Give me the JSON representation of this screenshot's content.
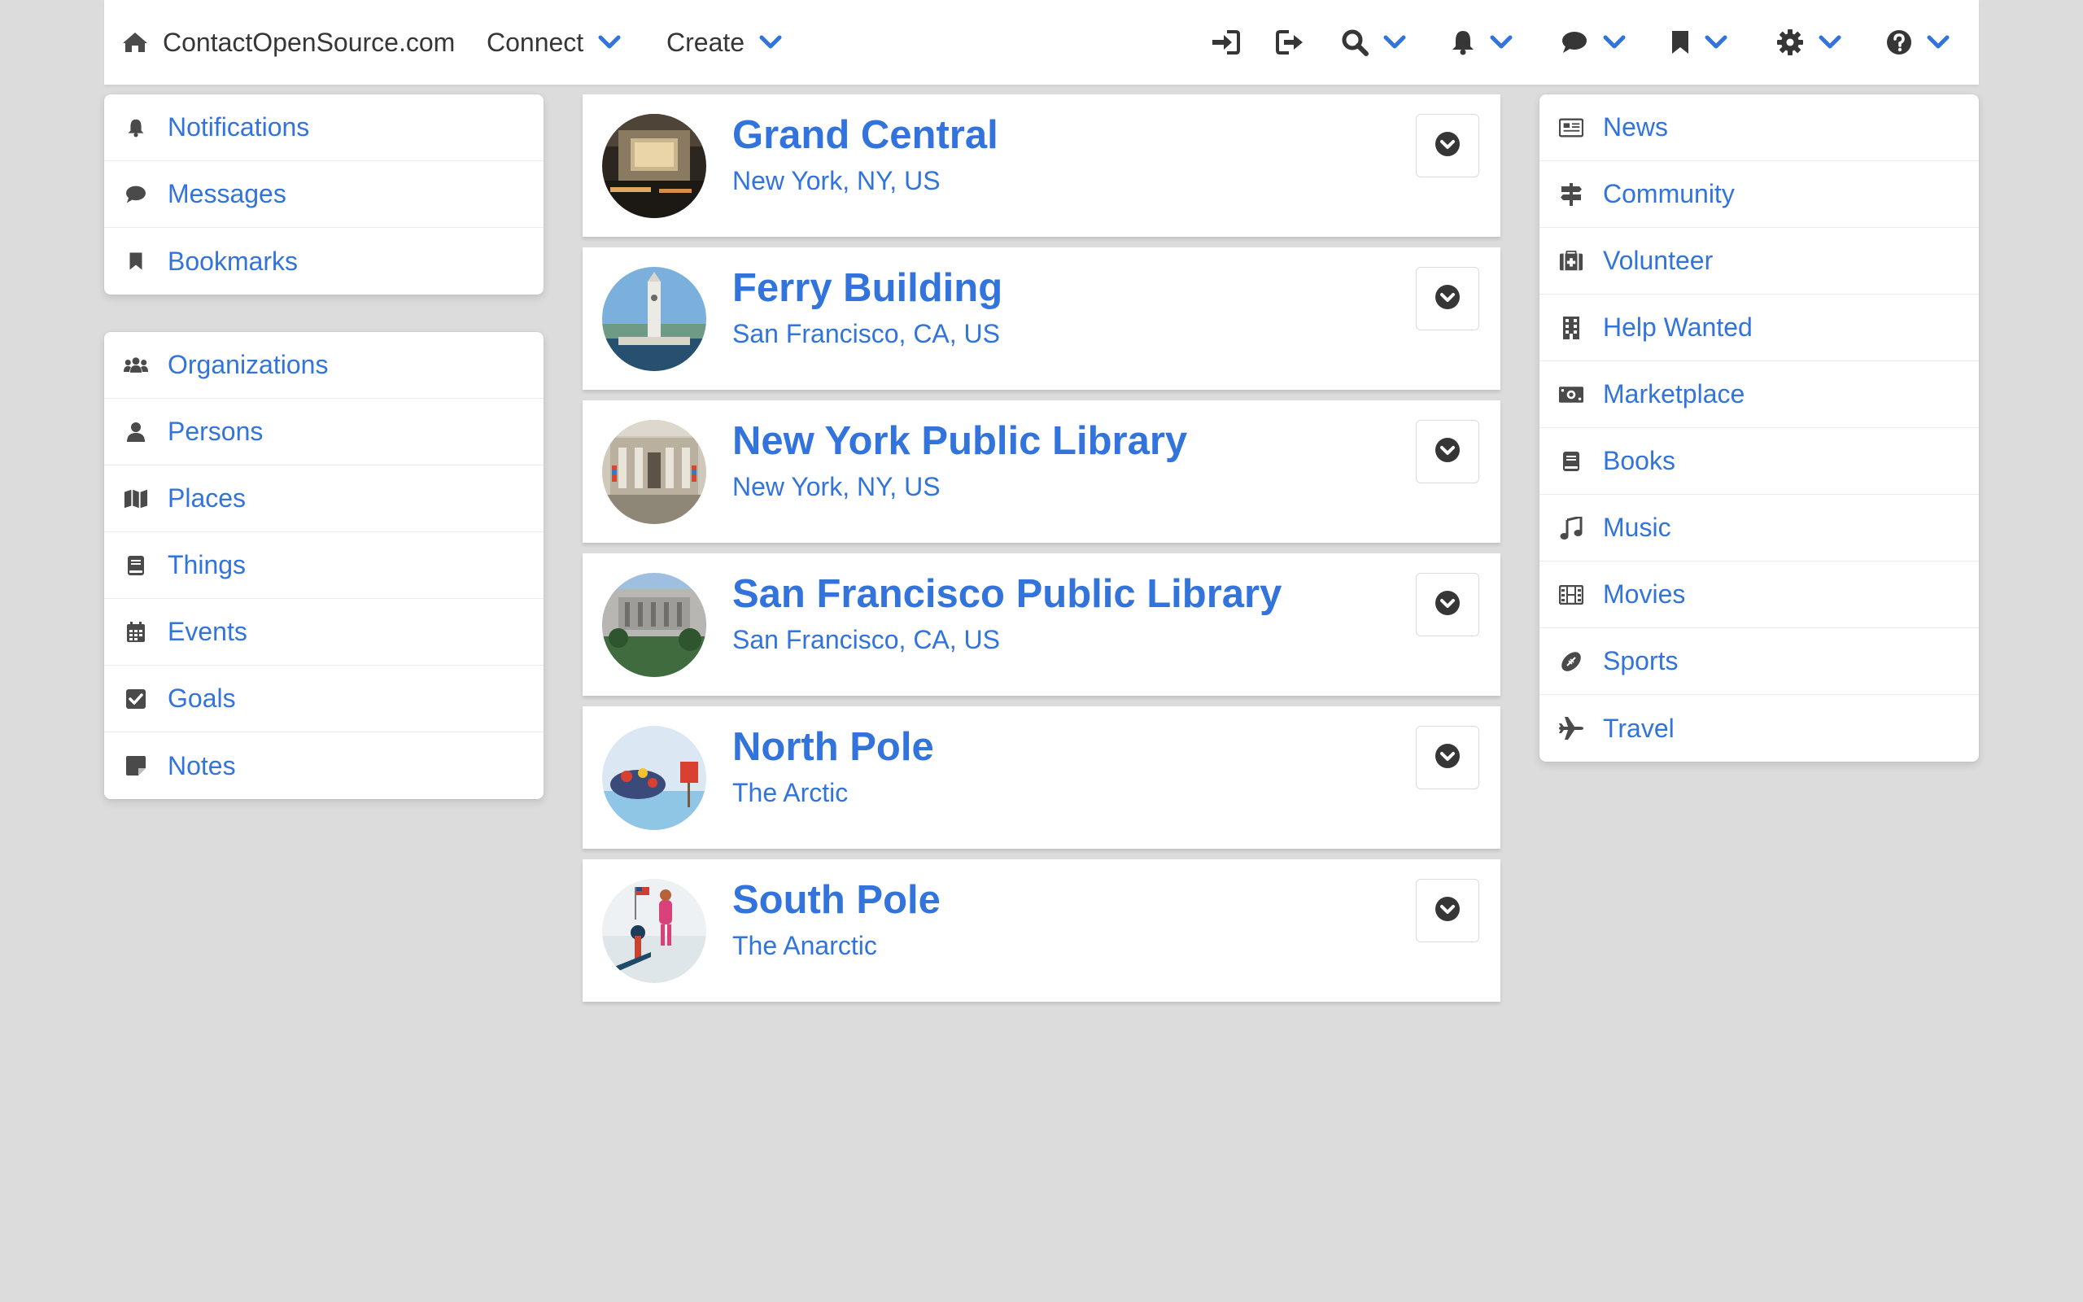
{
  "navbar": {
    "brand": "ContactOpenSource.com",
    "connect": "Connect",
    "create": "Create",
    "icons": [
      "home-icon",
      "sign-in-icon",
      "sign-out-icon",
      "search-icon",
      "bell-icon",
      "comment-icon",
      "bookmark-icon",
      "gear-icon",
      "question-icon"
    ]
  },
  "left_top_menu": [
    {
      "label": "Notifications",
      "icon": "bell-icon"
    },
    {
      "label": "Messages",
      "icon": "comment-icon"
    },
    {
      "label": "Bookmarks",
      "icon": "bookmark-icon"
    }
  ],
  "left_bottom_menu": [
    {
      "label": "Organizations",
      "icon": "users-icon"
    },
    {
      "label": "Persons",
      "icon": "user-icon"
    },
    {
      "label": "Places",
      "icon": "map-icon"
    },
    {
      "label": "Things",
      "icon": "book-icon"
    },
    {
      "label": "Events",
      "icon": "calendar-icon"
    },
    {
      "label": "Goals",
      "icon": "check-square-icon"
    },
    {
      "label": "Notes",
      "icon": "sticky-note-icon"
    }
  ],
  "right_menu": [
    {
      "label": "News",
      "icon": "newspaper-icon"
    },
    {
      "label": "Community",
      "icon": "signpost-icon"
    },
    {
      "label": "Volunteer",
      "icon": "medkit-icon"
    },
    {
      "label": "Help Wanted",
      "icon": "building-icon"
    },
    {
      "label": "Marketplace",
      "icon": "money-icon"
    },
    {
      "label": "Books",
      "icon": "book-icon"
    },
    {
      "label": "Music",
      "icon": "music-icon"
    },
    {
      "label": "Movies",
      "icon": "film-icon"
    },
    {
      "label": "Sports",
      "icon": "football-icon"
    },
    {
      "label": "Travel",
      "icon": "plane-icon"
    }
  ],
  "places": [
    {
      "title": "Grand Central",
      "subtitle": "New York, NY, US"
    },
    {
      "title": "Ferry Building",
      "subtitle": "San Francisco, CA, US"
    },
    {
      "title": "New York Public Library",
      "subtitle": "New York, NY, US"
    },
    {
      "title": "San Francisco Public Library",
      "subtitle": "San Francisco, CA, US"
    },
    {
      "title": "North Pole",
      "subtitle": "The Arctic"
    },
    {
      "title": "South Pole",
      "subtitle": "The Anarctic"
    }
  ],
  "colors": {
    "accent": "#3273dc",
    "text": "#363636",
    "icon": "#4a4a4a",
    "background": "#dcdcdc"
  }
}
